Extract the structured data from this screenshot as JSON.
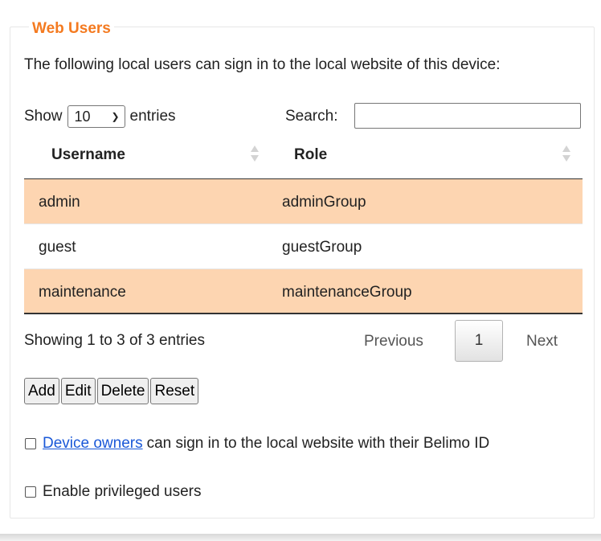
{
  "section": {
    "title": "Web Users",
    "intro": "The following local users can sign in to the local website of this device:"
  },
  "length": {
    "show_label": "Show",
    "value": "10",
    "suffix": "entries"
  },
  "search": {
    "label": "Search:",
    "value": "",
    "placeholder": ""
  },
  "table": {
    "columns": [
      "Username",
      "Role"
    ],
    "rows": [
      {
        "username": "admin",
        "role": "adminGroup"
      },
      {
        "username": "guest",
        "role": "guestGroup"
      },
      {
        "username": "maintenance",
        "role": "maintenanceGroup"
      }
    ],
    "highlight_color": "#fdd5b1"
  },
  "info": "Showing 1 to 3 of 3 entries",
  "pagination": {
    "previous": "Previous",
    "current": "1",
    "next": "Next"
  },
  "actions": {
    "add": "Add",
    "edit": "Edit",
    "delete": "Delete",
    "reset": "Reset"
  },
  "options": {
    "device_owners": {
      "link": "Device owners",
      "text": "can sign in to the local website with their Belimo ID",
      "checked": false
    },
    "privileged": {
      "text": "Enable privileged users",
      "checked": false
    }
  },
  "colors": {
    "accent": "#f47a20",
    "link": "#1a58d8"
  }
}
